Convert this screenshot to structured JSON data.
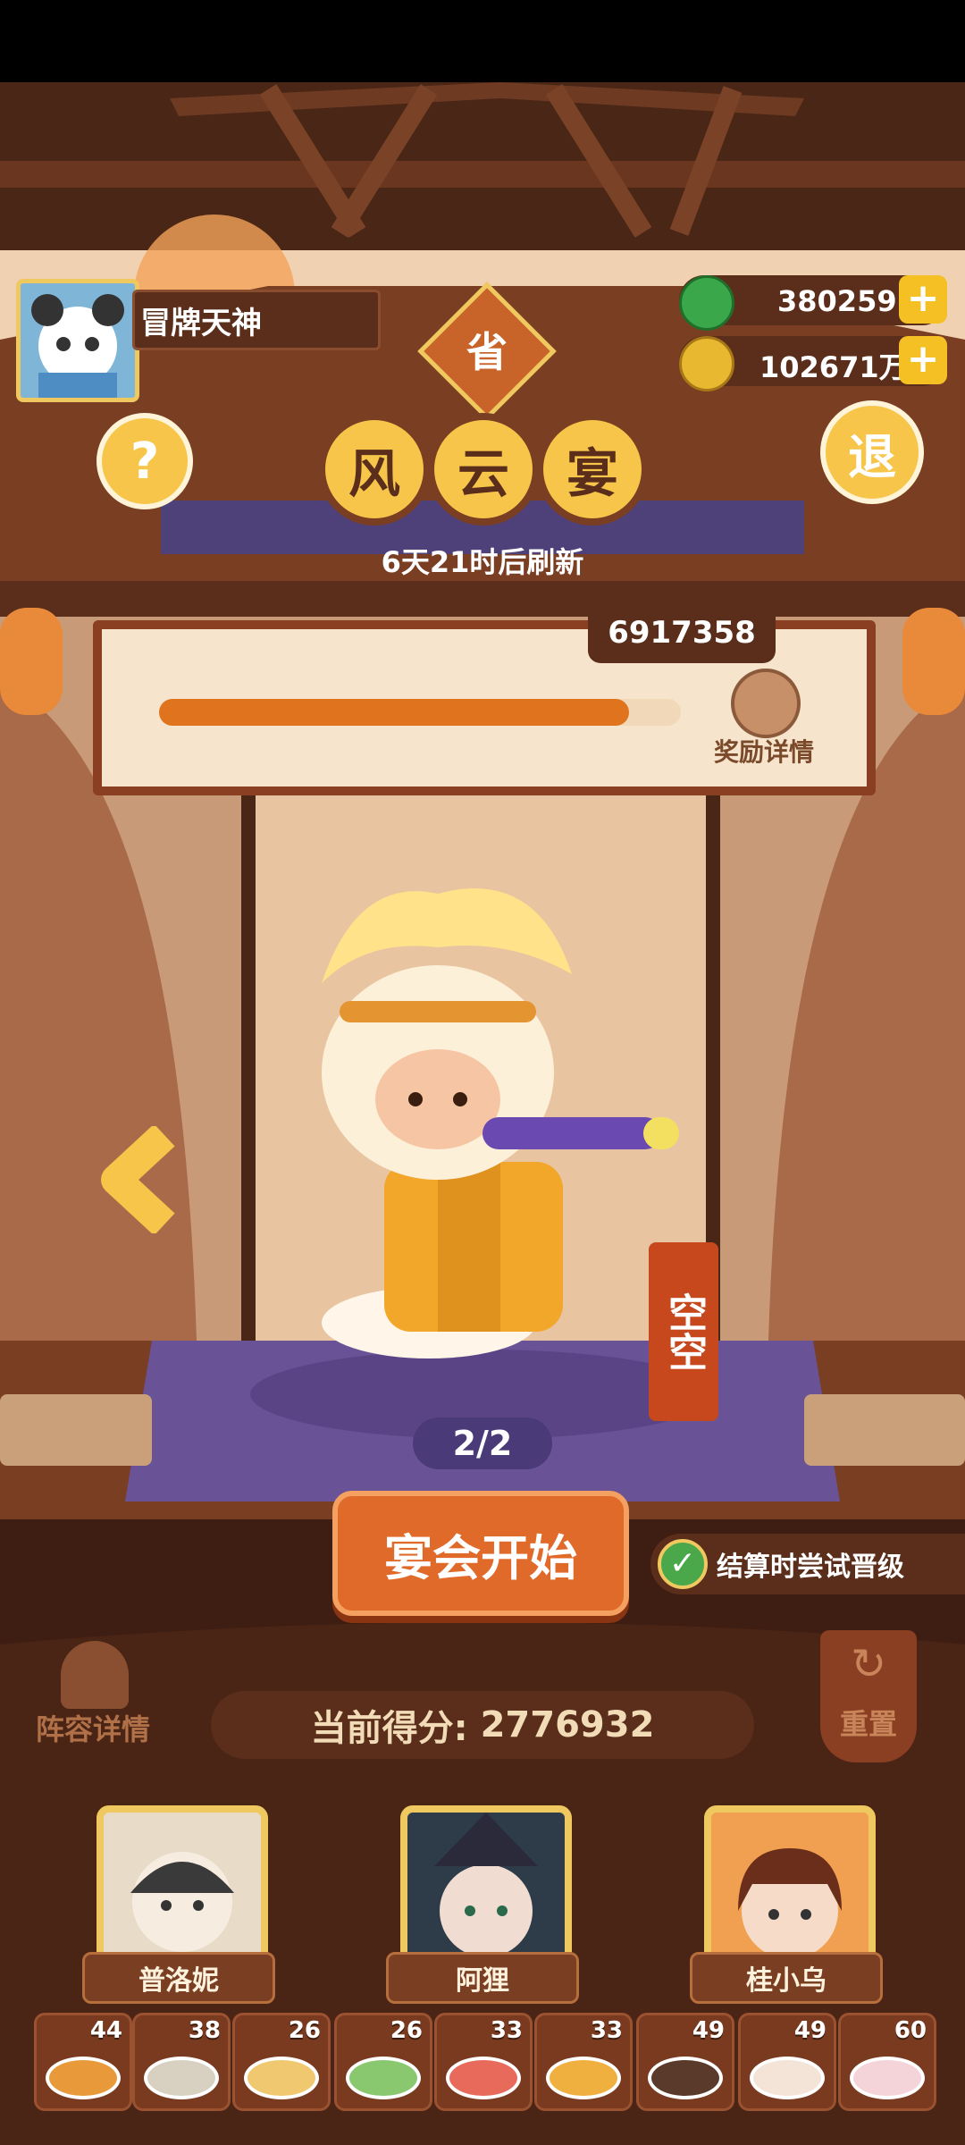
{
  "player": {
    "name": "冒牌天神"
  },
  "currency": {
    "jade": "380259",
    "coins": "102671万"
  },
  "header": {
    "province_badge": "省",
    "title_chars": [
      "风",
      "云",
      "宴"
    ],
    "refresh_text": "6天21时后刷新",
    "help_label": "?",
    "exit_label": "退"
  },
  "progress": {
    "score_bubble": "6917358",
    "fill": 0.9,
    "reward_label": "奖励详情"
  },
  "character": {
    "name_banner": "空空",
    "page_indicator": "2/2"
  },
  "actions": {
    "start_button": "宴会开始",
    "try_upgrade_label": "结算时尝试晋级",
    "try_upgrade_checked": true,
    "lineup_label": "阵容详情",
    "reset_label": "重置"
  },
  "score": {
    "label": "当前得分:",
    "value": "2776932"
  },
  "team": [
    {
      "name": "普洛妮"
    },
    {
      "name": "阿狸"
    },
    {
      "name": "桂小乌"
    }
  ],
  "foods": [
    {
      "count": "44",
      "icon": "dish-icon"
    },
    {
      "count": "38",
      "icon": "dish-icon"
    },
    {
      "count": "26",
      "icon": "dish-icon"
    },
    {
      "count": "26",
      "icon": "dish-icon"
    },
    {
      "count": "33",
      "icon": "dish-icon"
    },
    {
      "count": "33",
      "icon": "dish-icon"
    },
    {
      "count": "49",
      "icon": "dish-icon"
    },
    {
      "count": "49",
      "icon": "dish-icon"
    },
    {
      "count": "60",
      "icon": "dish-icon"
    }
  ],
  "colors": {
    "wood": "#5a2e1a",
    "orange_button": "#e06a2a",
    "progress_fill": "#e0741e",
    "gold": "#f0c860",
    "purple_stage": "#5e4a8c"
  }
}
